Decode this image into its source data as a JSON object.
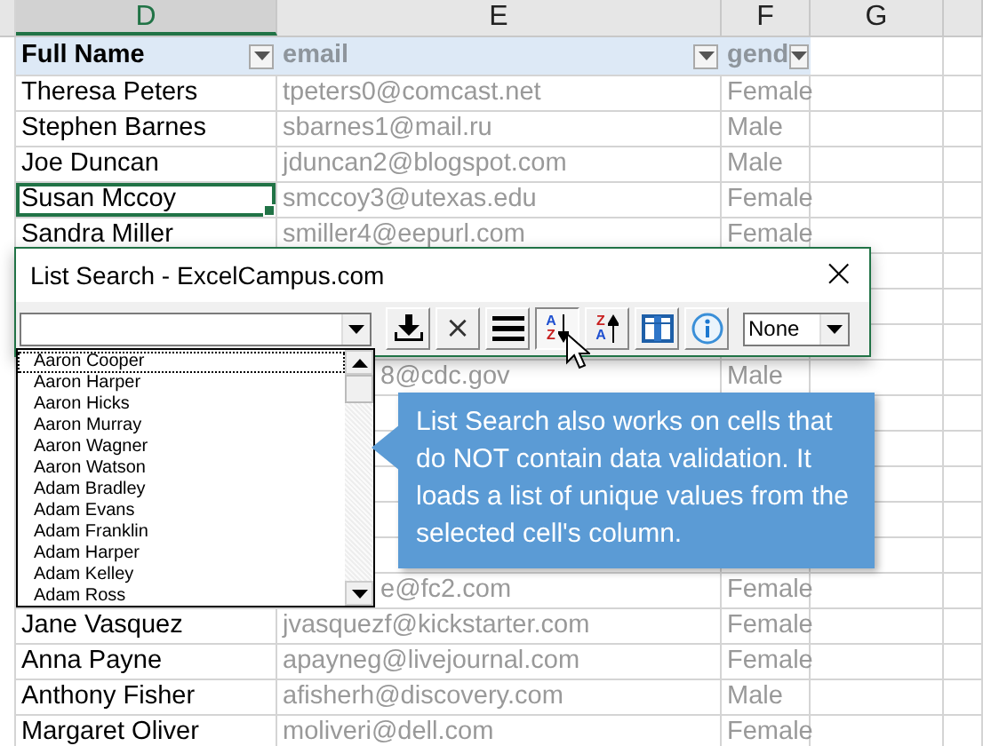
{
  "columns": [
    {
      "letter": "D",
      "selected": true
    },
    {
      "letter": "E",
      "selected": false
    },
    {
      "letter": "F",
      "selected": false
    },
    {
      "letter": "G",
      "selected": false
    }
  ],
  "table": {
    "headers": [
      "Full Name",
      "email",
      "gend"
    ],
    "rows": [
      {
        "name": "Theresa Peters",
        "email": "tpeters0@comcast.net",
        "gender": "Female",
        "selected": false
      },
      {
        "name": "Stephen Barnes",
        "email": "sbarnes1@mail.ru",
        "gender": "Male",
        "selected": false
      },
      {
        "name": "Joe Duncan",
        "email": "jduncan2@blogspot.com",
        "gender": "Male",
        "selected": false
      },
      {
        "name": "Susan Mccoy",
        "email": "smccoy3@utexas.edu",
        "gender": "Female",
        "selected": true
      },
      {
        "name": "Sandra Miller",
        "email": "smiller4@eepurl.com",
        "gender": "Female",
        "selected": false
      },
      {},
      {},
      {},
      {
        "email": "8@cdc.gov",
        "gender": "Male"
      },
      {},
      {},
      {},
      {},
      {},
      {
        "email": "e@fc2.com",
        "gender": "Female"
      },
      {
        "name": "Jane Vasquez",
        "email": "jvasquezf@kickstarter.com",
        "gender": "Female",
        "selected": false
      },
      {
        "name": "Anna Payne",
        "email": "apayneg@livejournal.com",
        "gender": "Female",
        "selected": false
      },
      {
        "name": "Anthony Fisher",
        "email": "afisherh@discovery.com",
        "gender": "Male",
        "selected": false
      },
      {
        "name": "Margaret Oliver",
        "email": "moliveri@dell.com",
        "gender": "Female",
        "selected": false
      }
    ]
  },
  "dialog": {
    "title": "List Search - ExcelCampus.com",
    "close": "×",
    "toolbar": [
      {
        "kind": "insert",
        "selected": false
      },
      {
        "kind": "clear",
        "label": "×",
        "selected": false
      },
      {
        "kind": "lines",
        "selected": false
      },
      {
        "kind": "sort-asc",
        "letters": [
          "A",
          "Z"
        ],
        "selected": true
      },
      {
        "kind": "sort-desc",
        "letters": [
          "Z",
          "A"
        ],
        "selected": false
      },
      {
        "kind": "columns",
        "selected": false
      },
      {
        "kind": "info",
        "selected": false
      }
    ],
    "sort_select": {
      "value": "None"
    },
    "list": [
      {
        "label": "Aaron Cooper",
        "selected": true
      },
      {
        "label": "Aaron Harper",
        "selected": false
      },
      {
        "label": "Aaron Hicks",
        "selected": false
      },
      {
        "label": "Aaron Murray",
        "selected": false
      },
      {
        "label": "Aaron Wagner",
        "selected": false
      },
      {
        "label": "Aaron Watson",
        "selected": false
      },
      {
        "label": "Adam Bradley",
        "selected": false
      },
      {
        "label": "Adam Evans",
        "selected": false
      },
      {
        "label": "Adam Franklin",
        "selected": false
      },
      {
        "label": "Adam Harper",
        "selected": false
      },
      {
        "label": "Adam Kelley",
        "selected": false
      },
      {
        "label": "Adam Ross",
        "selected": false
      }
    ]
  },
  "callout": {
    "text": "List Search also works on cells that do NOT contain data validation.  It loads a list of unique values from the selected cell's column."
  }
}
